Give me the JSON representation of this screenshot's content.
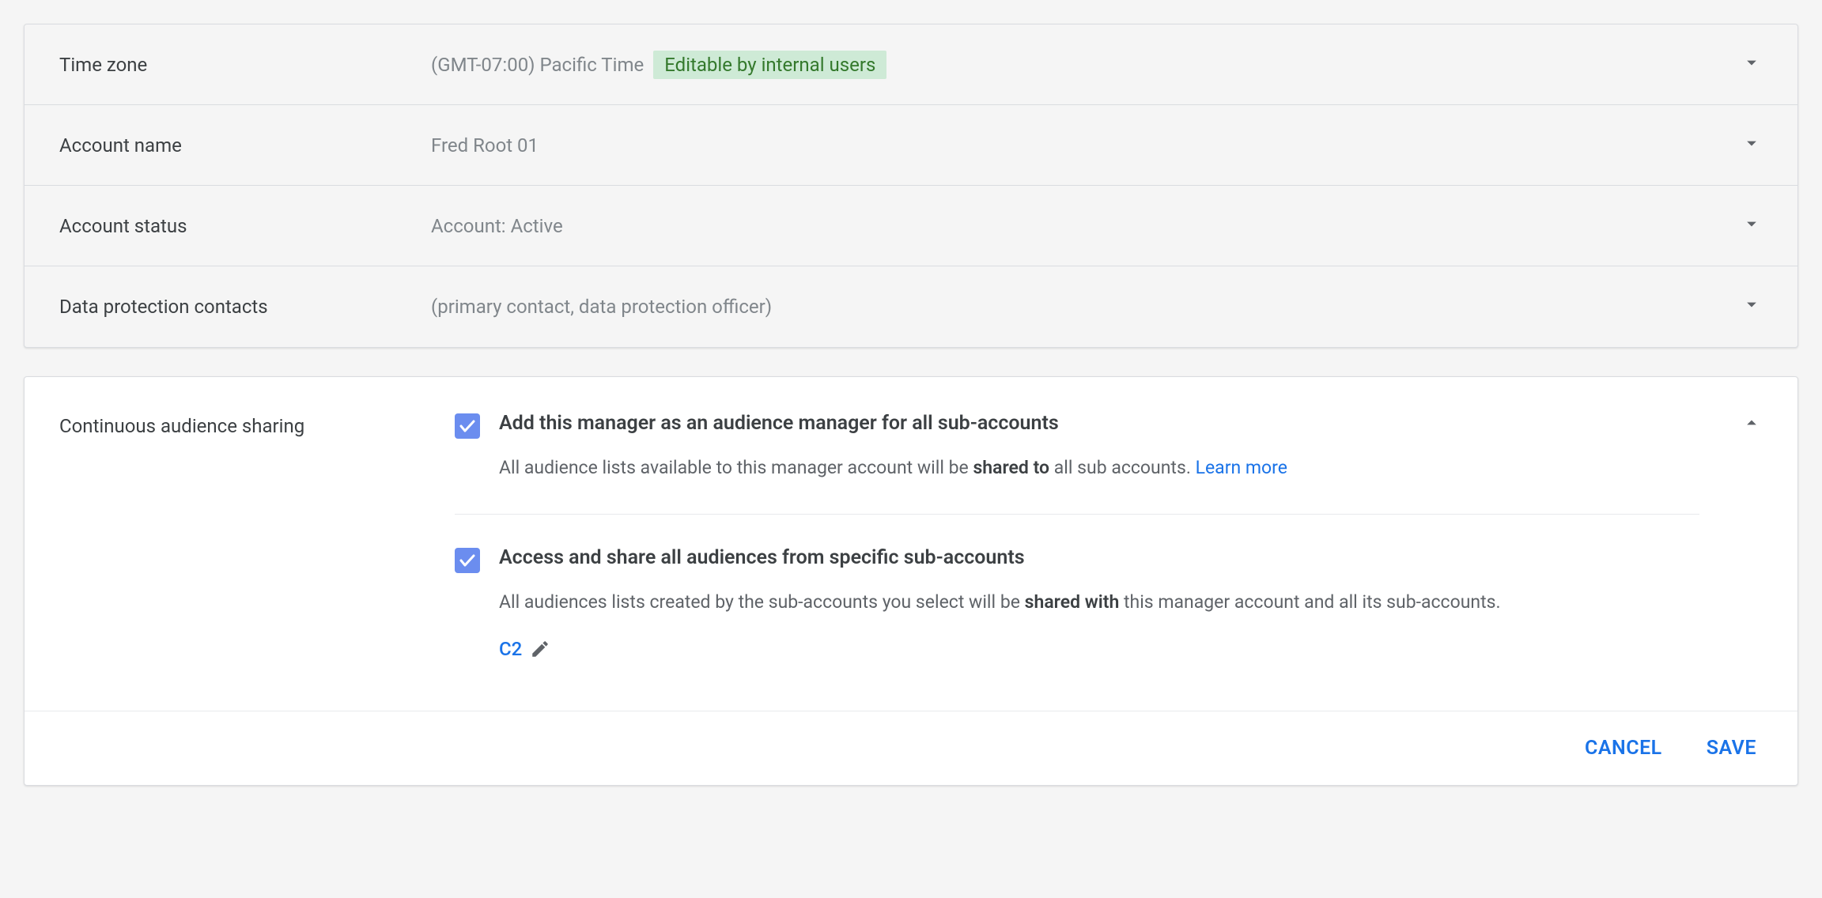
{
  "rows": {
    "timezone": {
      "label": "Time zone",
      "value": "(GMT-07:00) Pacific Time",
      "badge": "Editable by internal users"
    },
    "accountName": {
      "label": "Account name",
      "value": "Fred Root 01"
    },
    "accountStatus": {
      "label": "Account status",
      "value": "Account: Active"
    },
    "dataProtection": {
      "label": "Data protection contacts",
      "value": "(primary contact, data protection officer)"
    }
  },
  "sharing": {
    "section_label": "Continuous audience sharing",
    "opt1": {
      "title": "Add this manager as an audience manager for all sub-accounts",
      "desc_pre": "All audience lists available to this manager account will be ",
      "desc_bold": "shared to",
      "desc_post": " all sub accounts. ",
      "learn_more": "Learn more"
    },
    "opt2": {
      "title": "Access and share all audiences from specific sub-accounts",
      "desc_pre": "All audiences lists created by the sub-accounts you select will be ",
      "desc_bold": "shared with",
      "desc_post": " this manager account and all its sub-accounts.",
      "tag": "C2"
    }
  },
  "footer": {
    "cancel": "CANCEL",
    "save": "SAVE"
  }
}
